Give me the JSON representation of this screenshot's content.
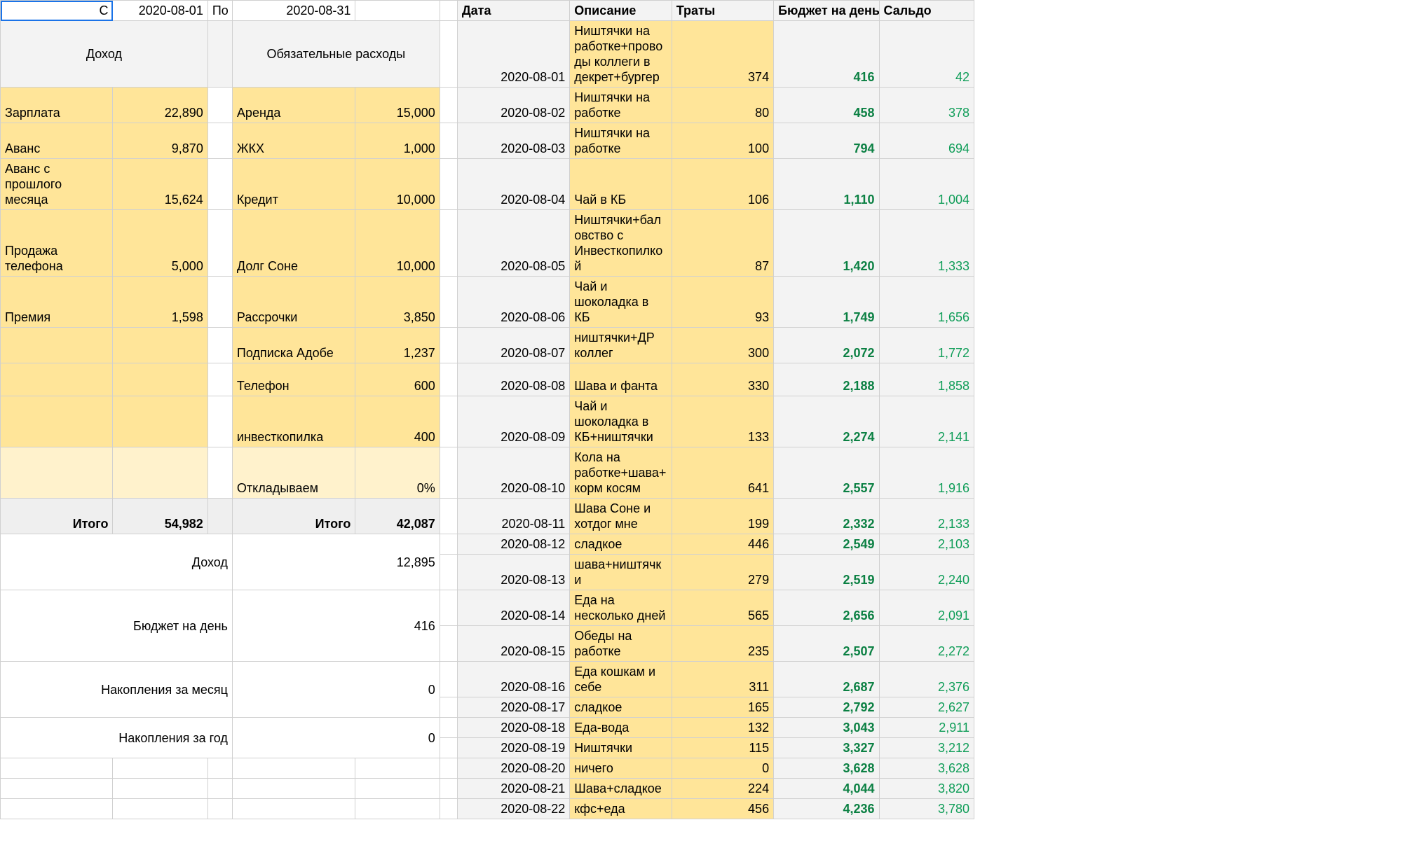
{
  "period": {
    "from_label": "С",
    "from": "2020-08-01",
    "to_label": "По",
    "to": "2020-08-31"
  },
  "headers": {
    "income": "Доход",
    "mandatory": "Обязательные расходы",
    "date": "Дата",
    "desc": "Описание",
    "spend": "Траты",
    "budget": "Бюджет на день",
    "balance": "Сальдо"
  },
  "income": [
    {
      "label": "Зарплата",
      "value": "22,890"
    },
    {
      "label": "Аванс",
      "value": "9,870"
    },
    {
      "label": "Аванс с прошлого месяца",
      "value": "15,624"
    },
    {
      "label": "Продажа телефона",
      "value": "5,000"
    },
    {
      "label": "Премия",
      "value": "1,598"
    },
    {
      "label": "",
      "value": ""
    },
    {
      "label": "",
      "value": ""
    },
    {
      "label": "",
      "value": ""
    },
    {
      "label": "",
      "value": ""
    }
  ],
  "mandatory": [
    {
      "label": "Аренда",
      "value": "15,000"
    },
    {
      "label": "ЖКХ",
      "value": "1,000"
    },
    {
      "label": "Кредит",
      "value": "10,000"
    },
    {
      "label": "Долг Соне",
      "value": "10,000"
    },
    {
      "label": "Рассрочки",
      "value": "3,850"
    },
    {
      "label": "Подписка Адобе",
      "value": "1,237"
    },
    {
      "label": "Телефон",
      "value": "600"
    },
    {
      "label": "инвесткопилка",
      "value": "400"
    },
    {
      "label": "Откладываем",
      "value": "0%"
    }
  ],
  "totals": {
    "itogo_label": "Итого",
    "income_total": "54,982",
    "mandatory_total": "42,087"
  },
  "summary": [
    {
      "label": "Доход",
      "value": "12,895"
    },
    {
      "label": "Бюджет на день",
      "value": "416"
    },
    {
      "label": "Накопления за месяц",
      "value": "0"
    },
    {
      "label": "Накопления за год",
      "value": "0"
    }
  ],
  "log": [
    {
      "date": "2020-08-01",
      "desc": "Ништячки на работке+проводы коллеги в декрет+бургер",
      "spend": "374",
      "budget": "416",
      "bal": "42"
    },
    {
      "date": "2020-08-02",
      "desc": "Ништячки на работке",
      "spend": "80",
      "budget": "458",
      "bal": "378"
    },
    {
      "date": "2020-08-03",
      "desc": "Ништячки на работке",
      "spend": "100",
      "budget": "794",
      "bal": "694"
    },
    {
      "date": "2020-08-04",
      "desc": "Чай в КБ",
      "spend": "106",
      "budget": "1,110",
      "bal": "1,004"
    },
    {
      "date": "2020-08-05",
      "desc": "Ништячки+баловство с Инвесткопилкой",
      "spend": "87",
      "budget": "1,420",
      "bal": "1,333"
    },
    {
      "date": "2020-08-06",
      "desc": "Чай и шоколадка в КБ",
      "spend": "93",
      "budget": "1,749",
      "bal": "1,656"
    },
    {
      "date": "2020-08-07",
      "desc": "ништячки+ДР коллег",
      "spend": "300",
      "budget": "2,072",
      "bal": "1,772"
    },
    {
      "date": "2020-08-08",
      "desc": "Шава и фанта",
      "spend": "330",
      "budget": "2,188",
      "bal": "1,858"
    },
    {
      "date": "2020-08-09",
      "desc": "Чай и шоколадка в КБ+ништячки",
      "spend": "133",
      "budget": "2,274",
      "bal": "2,141"
    },
    {
      "date": "2020-08-10",
      "desc": "Кола на работке+шава+корм косям",
      "spend": "641",
      "budget": "2,557",
      "bal": "1,916"
    },
    {
      "date": "2020-08-11",
      "desc": "Шава Соне и хотдог мне",
      "spend": "199",
      "budget": "2,332",
      "bal": "2,133"
    },
    {
      "date": "2020-08-12",
      "desc": "сладкое",
      "spend": "446",
      "budget": "2,549",
      "bal": "2,103"
    },
    {
      "date": "2020-08-13",
      "desc": "шава+ништячки",
      "spend": "279",
      "budget": "2,519",
      "bal": "2,240"
    },
    {
      "date": "2020-08-14",
      "desc": "Еда на несколько дней",
      "spend": "565",
      "budget": "2,656",
      "bal": "2,091"
    },
    {
      "date": "2020-08-15",
      "desc": "Обеды на работке",
      "spend": "235",
      "budget": "2,507",
      "bal": "2,272"
    },
    {
      "date": "2020-08-16",
      "desc": "Еда кошкам и себе",
      "spend": "311",
      "budget": "2,687",
      "bal": "2,376"
    },
    {
      "date": "2020-08-17",
      "desc": "сладкое",
      "spend": "165",
      "budget": "2,792",
      "bal": "2,627"
    },
    {
      "date": "2020-08-18",
      "desc": "Еда-вода",
      "spend": "132",
      "budget": "3,043",
      "bal": "2,911"
    },
    {
      "date": "2020-08-19",
      "desc": "Ништячки",
      "spend": "115",
      "budget": "3,327",
      "bal": "3,212"
    },
    {
      "date": "2020-08-20",
      "desc": "ничего",
      "spend": "0",
      "budget": "3,628",
      "bal": "3,628"
    },
    {
      "date": "2020-08-21",
      "desc": "Шава+сладкое",
      "spend": "224",
      "budget": "4,044",
      "bal": "3,820"
    },
    {
      "date": "2020-08-22",
      "desc": "кфс+еда",
      "spend": "456",
      "budget": "4,236",
      "bal": "3,780"
    }
  ]
}
